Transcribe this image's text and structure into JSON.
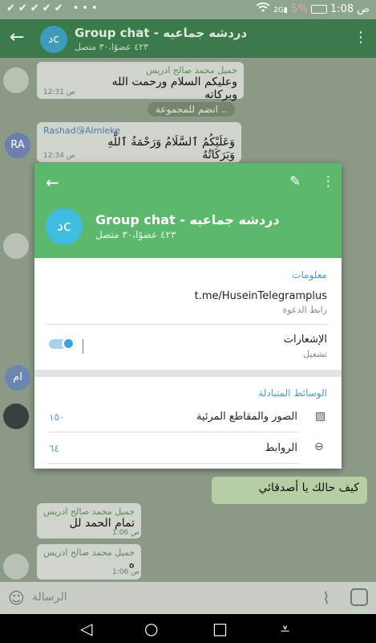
{
  "status_bar": {
    "time": "1:08",
    "ampm": "ص",
    "battery": "5%",
    "notif_checks": "✔✔✔✔✔",
    "dots": "•••"
  },
  "app_bar": {
    "avatar_initials": "دc",
    "title": "Group chat - دردشه جماعيه",
    "subtitle": "٤٢٣ عضوًا،٣٠ متصل"
  },
  "messages": [
    {
      "sender": "جميل محمد صالح ادريس",
      "text": "وعليكم السلام ورحمت الله وبركاته",
      "time": "12:31 ص"
    },
    {
      "system": "انضم للمجموعة .."
    },
    {
      "sender": "Rashad😘Almleke",
      "avatar": "RA",
      "text": "وَعَلَيْكُمُ ٱلسَّلَامُ وَرَحْمَةُ ٱللَّهِ وَبَرَكَاتُهُ",
      "time": "12:34 ص"
    },
    {
      "avatar": "ام"
    },
    {
      "outgoing": "كيف حالك يا أصدقائي"
    },
    {
      "sender": "جميل محمد صالح ادريس",
      "text": "تمام الحمد لل",
      "time": "1:06 ص"
    },
    {
      "sender": "جميل محمد صالح ادريس",
      "text": "ه",
      "time": "1:06 ص"
    }
  ],
  "input": {
    "placeholder": "الرسالة"
  },
  "dialog": {
    "avatar_initials": "دc",
    "title": "Group chat - دردشه جماعيه",
    "subtitle": "٤٢٣ عضوًا،٣٠ متصل",
    "info_title": "معلومات",
    "invite_link": "t.me/HuseinTelegramplus",
    "invite_link_label": "رابط الدعوة",
    "notifications_label": "الإشعارات",
    "notifications_state": "تشغيل",
    "shared_media_title": "الوسائط المتبادلة",
    "media_items": [
      {
        "label": "الصور والمقاطع المرئية",
        "count": "١٥٠"
      },
      {
        "label": "الروابط",
        "count": "٦٤"
      }
    ]
  }
}
